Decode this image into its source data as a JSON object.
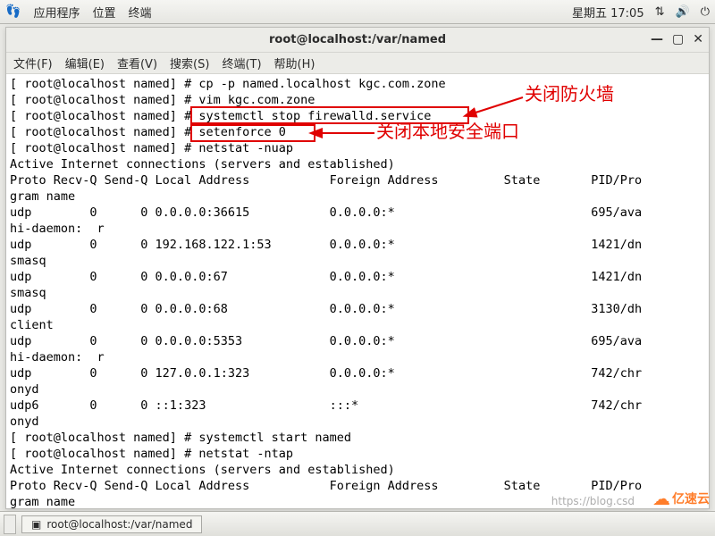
{
  "gnome": {
    "apps": "应用程序",
    "places": "位置",
    "terminal": "终端",
    "clock": "星期五 17:05"
  },
  "window": {
    "title": "root@localhost:/var/named",
    "menus": {
      "file": "文件(F)",
      "edit": "编辑(E)",
      "view": "查看(V)",
      "search": "搜索(S)",
      "terminal": "终端(T)",
      "help": "帮助(H)"
    }
  },
  "terminal_lines": [
    "[ root@localhost named] # cp -p named.localhost kgc.com.zone",
    "[ root@localhost named] # vim kgc.com.zone",
    "[ root@localhost named] # systemctl stop firewalld.service",
    "[ root@localhost named] # setenforce 0",
    "[ root@localhost named] # netstat -nuap",
    "Active Internet connections (servers and established)",
    "Proto Recv-Q Send-Q Local Address           Foreign Address         State       PID/Pro",
    "gram name",
    "udp        0      0 0.0.0.0:36615           0.0.0.0:*                           695/ava",
    "hi-daemon:  r",
    "udp        0      0 192.168.122.1:53        0.0.0.0:*                           1421/dn",
    "smasq",
    "udp        0      0 0.0.0.0:67              0.0.0.0:*                           1421/dn",
    "smasq",
    "udp        0      0 0.0.0.0:68              0.0.0.0:*                           3130/dh",
    "client",
    "udp        0      0 0.0.0.0:5353            0.0.0.0:*                           695/ava",
    "hi-daemon:  r",
    "udp        0      0 127.0.0.1:323           0.0.0.0:*                           742/chr",
    "onyd",
    "udp6       0      0 ::1:323                 :::*                                742/chr",
    "onyd",
    "[ root@localhost named] # systemctl start named",
    "[ root@localhost named] # netstat -ntap",
    "Active Internet connections (servers and established)",
    "Proto Recv-Q Send-Q Local Address           Foreign Address         State       PID/Pro",
    "gram name"
  ],
  "annotations": {
    "firewall": "关闭防火墙",
    "selinux": "关闭本地安全端口"
  },
  "taskbar": {
    "task1": "root@localhost:/var/named"
  },
  "watermarks": {
    "csdn": "https://blog.csd",
    "yisuyun": "亿速云"
  }
}
